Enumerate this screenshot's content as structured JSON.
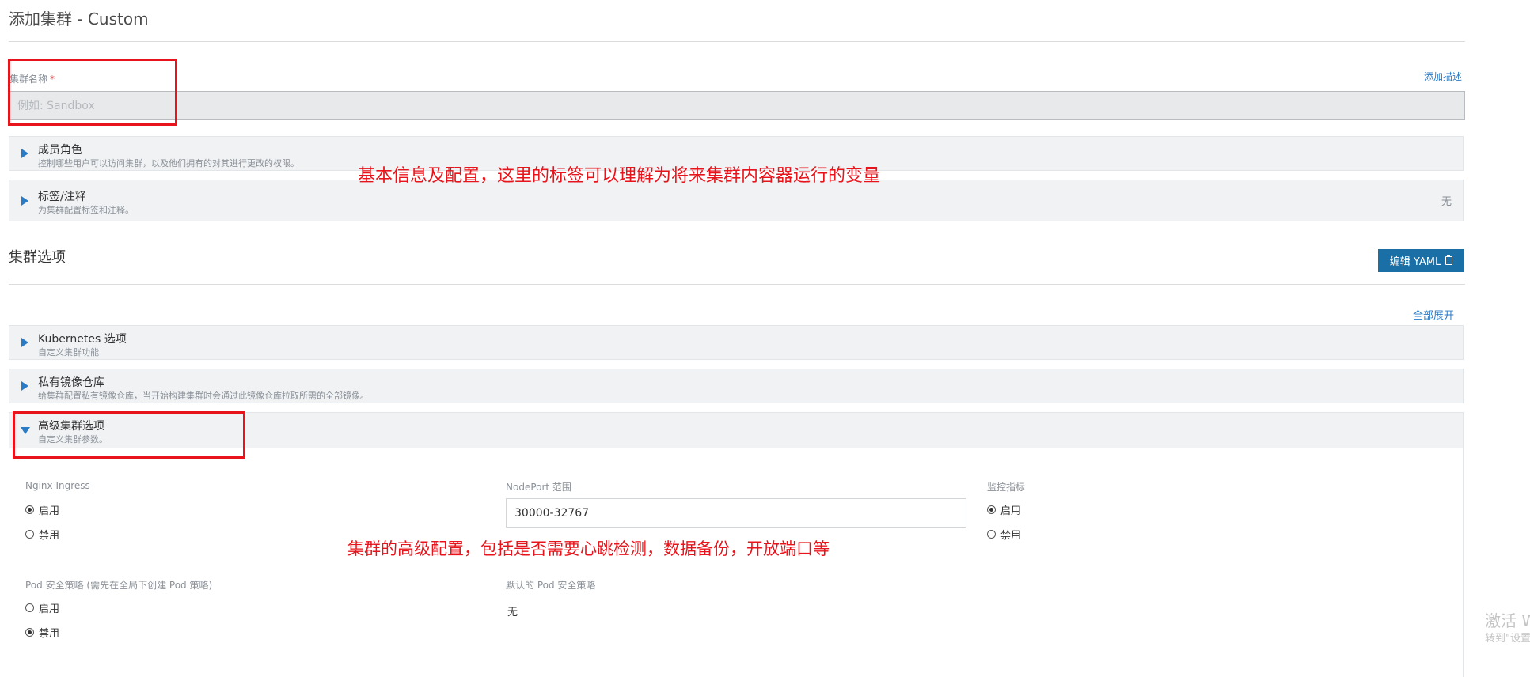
{
  "header": {
    "title": "添加集群 - Custom"
  },
  "cluster_name": {
    "label": "集群名称",
    "required_mark": "*",
    "placeholder": "例如: Sandbox",
    "add_description": "添加描述"
  },
  "panels_basic": [
    {
      "title": "成员角色",
      "subtitle": "控制哪些用户可以访问集群，以及他们拥有的对其进行更改的权限。",
      "right": ""
    },
    {
      "title": "标签/注释",
      "subtitle": "为集群配置标签和注释。",
      "right": "无"
    }
  ],
  "cluster_options": {
    "title": "集群选项",
    "edit_yaml": "编辑 YAML",
    "expand_all": "全部展开"
  },
  "panels_options": [
    {
      "title": "Kubernetes 选项",
      "subtitle": "自定义集群功能"
    },
    {
      "title": "私有镜像仓库",
      "subtitle": "给集群配置私有镜像仓库，当开始构建集群时会通过此镜像仓库拉取所需的全部镜像。"
    },
    {
      "title": "高级集群选项",
      "subtitle": "自定义集群参数。"
    }
  ],
  "advanced": {
    "nginx_ingress": {
      "label": "Nginx Ingress",
      "enable": "启用",
      "disable": "禁用",
      "selected": "enable"
    },
    "nodeport": {
      "label": "NodePort 范围",
      "value": "30000-32767"
    },
    "monitoring": {
      "label": "监控指标",
      "enable": "启用",
      "disable": "禁用",
      "selected": "enable"
    },
    "pod_security": {
      "label": "Pod 安全策略 (需先在全局下创建 Pod 策略)",
      "enable": "启用",
      "disable": "禁用",
      "selected": "disable"
    },
    "default_pod_security": {
      "label": "默认的 Pod 安全策略",
      "value": "无"
    }
  },
  "annotations": {
    "basic_note": "基本信息及配置，这里的标签可以理解为将来集群内容器运行的变量",
    "advanced_note": "集群的高级配置，包括是否需要心跳检测，数据备份，开放端口等"
  },
  "watermark": {
    "line1": "激活 W",
    "line2": "转到\"设置"
  },
  "colors": {
    "accent": "#2a7bc5",
    "button": "#1a6fa6",
    "annotation_red": "#e8141b",
    "panel_bg": "#f0f2f4"
  }
}
